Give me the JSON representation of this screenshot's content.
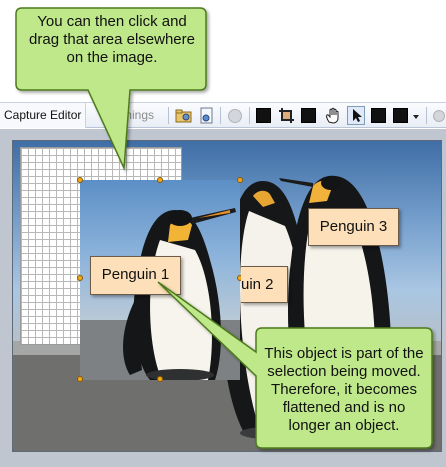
{
  "toolbar": {
    "tab_capture_label": "Capture Editor",
    "tab_markings_label": "mings"
  },
  "labels": {
    "penguin1": "Penguin 1",
    "penguin2": "uin 2",
    "penguin3": "Penguin 3"
  },
  "callouts": {
    "top": "You can then click and drag that area elsewhere on the image.",
    "bottom": "This object is part of the selection being moved. Therefore, it becomes flattened and is no longer an object."
  },
  "colors": {
    "callout_fill": "#bfe88a",
    "callout_border": "#4d7a1c",
    "label_fill": "#fde0b9",
    "handle": "#f2a81d"
  }
}
